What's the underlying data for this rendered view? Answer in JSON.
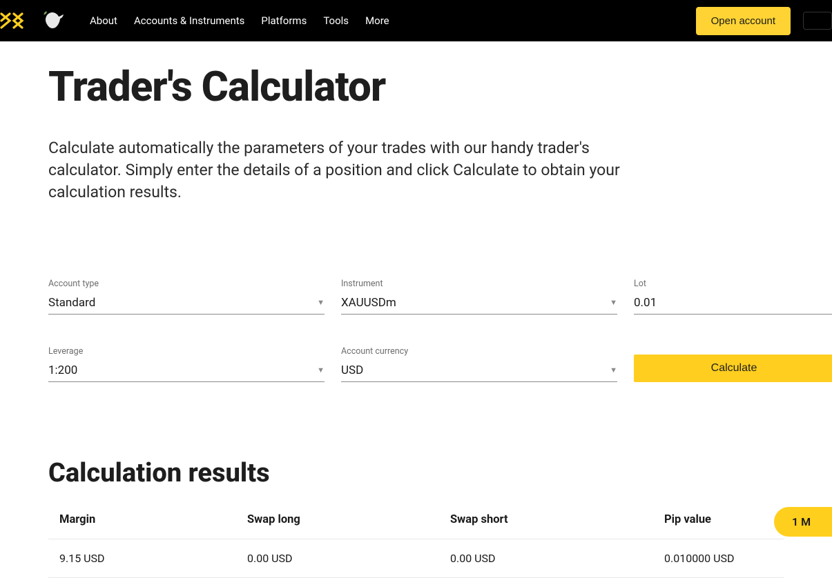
{
  "nav": {
    "links": [
      "About",
      "Accounts & Instruments",
      "Platforms",
      "Tools",
      "More"
    ],
    "open_account": "Open account"
  },
  "page": {
    "title": "Trader's Calculator",
    "description": "Calculate automatically the parameters of your trades with our handy trader's calculator. Simply enter the details of a position and click Calculate to obtain your calculation results."
  },
  "form": {
    "account_type": {
      "label": "Account type",
      "value": "Standard"
    },
    "instrument": {
      "label": "Instrument",
      "value": "XAUUSDm"
    },
    "lot": {
      "label": "Lot",
      "value": "0.01"
    },
    "leverage": {
      "label": "Leverage",
      "value": "1:200"
    },
    "account_currency": {
      "label": "Account currency",
      "value": "USD"
    },
    "calculate_label": "Calculate"
  },
  "results": {
    "title": "Calculation results",
    "headers": [
      "Margin",
      "Swap long",
      "Swap short",
      "Pip value"
    ],
    "row": [
      "9.15 USD",
      "0.00 USD",
      "0.00 USD",
      "0.010000 USD"
    ]
  },
  "floating": {
    "label": "1 M"
  }
}
